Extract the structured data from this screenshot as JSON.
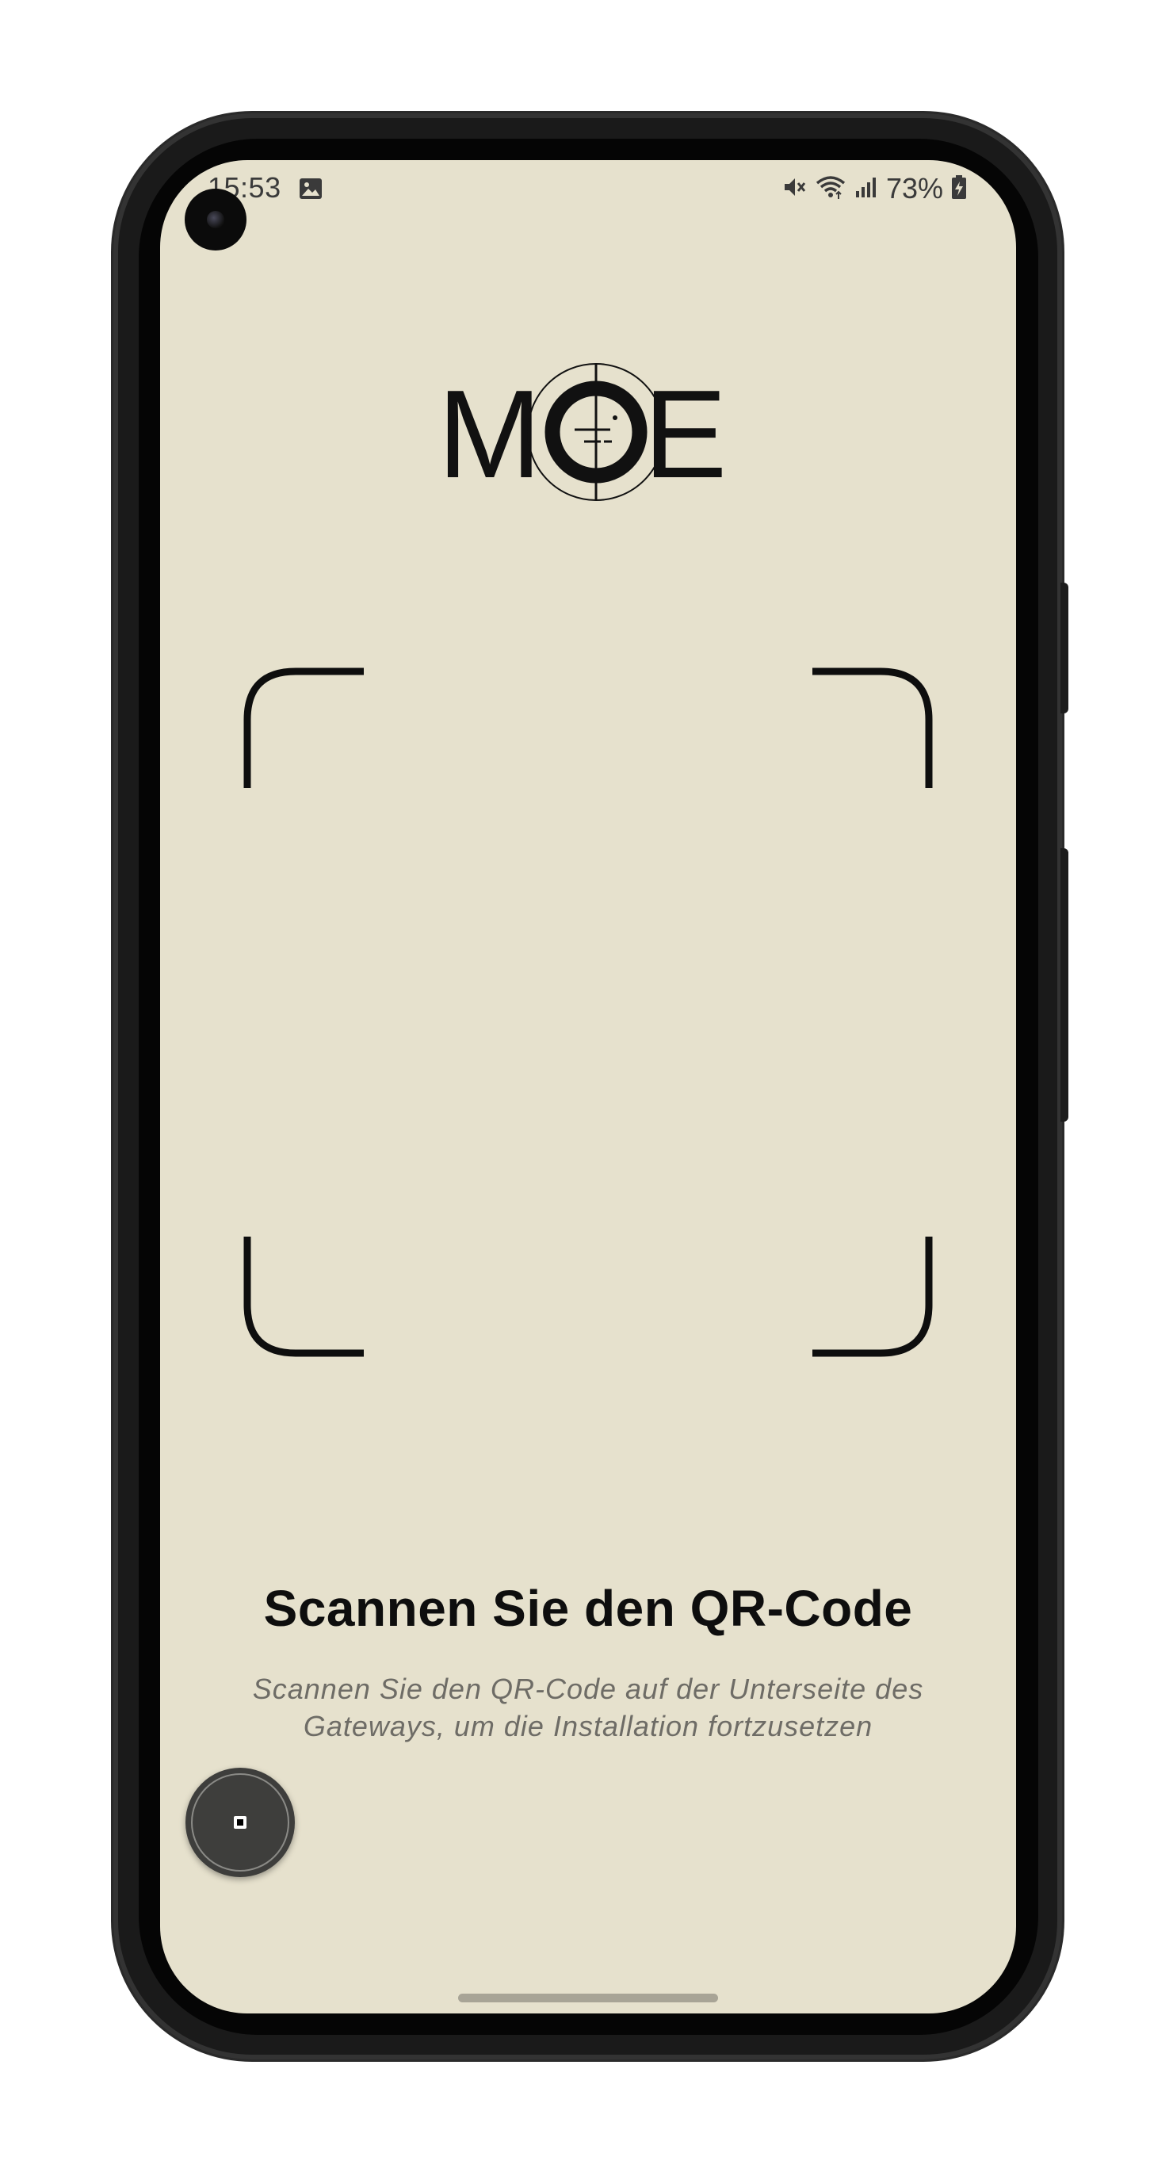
{
  "status_bar": {
    "time": "15:53",
    "battery_percent": "73%",
    "icons": [
      "gallery-notification-icon",
      "mute-icon",
      "wifi-icon",
      "signal-icon",
      "battery-charging-icon"
    ]
  },
  "logo": {
    "text": "MOE"
  },
  "scanner": {
    "title": "Scannen Sie den QR-Code",
    "description": "Scannen Sie den QR-Code auf der Unterseite des Gateways, um die Installation fortzusetzen"
  },
  "colors": {
    "screen_background": "#e6e1cd",
    "frame": "#0e0e0e",
    "subtitle": "#6e6c66",
    "home_indicator": "#a8a496"
  }
}
